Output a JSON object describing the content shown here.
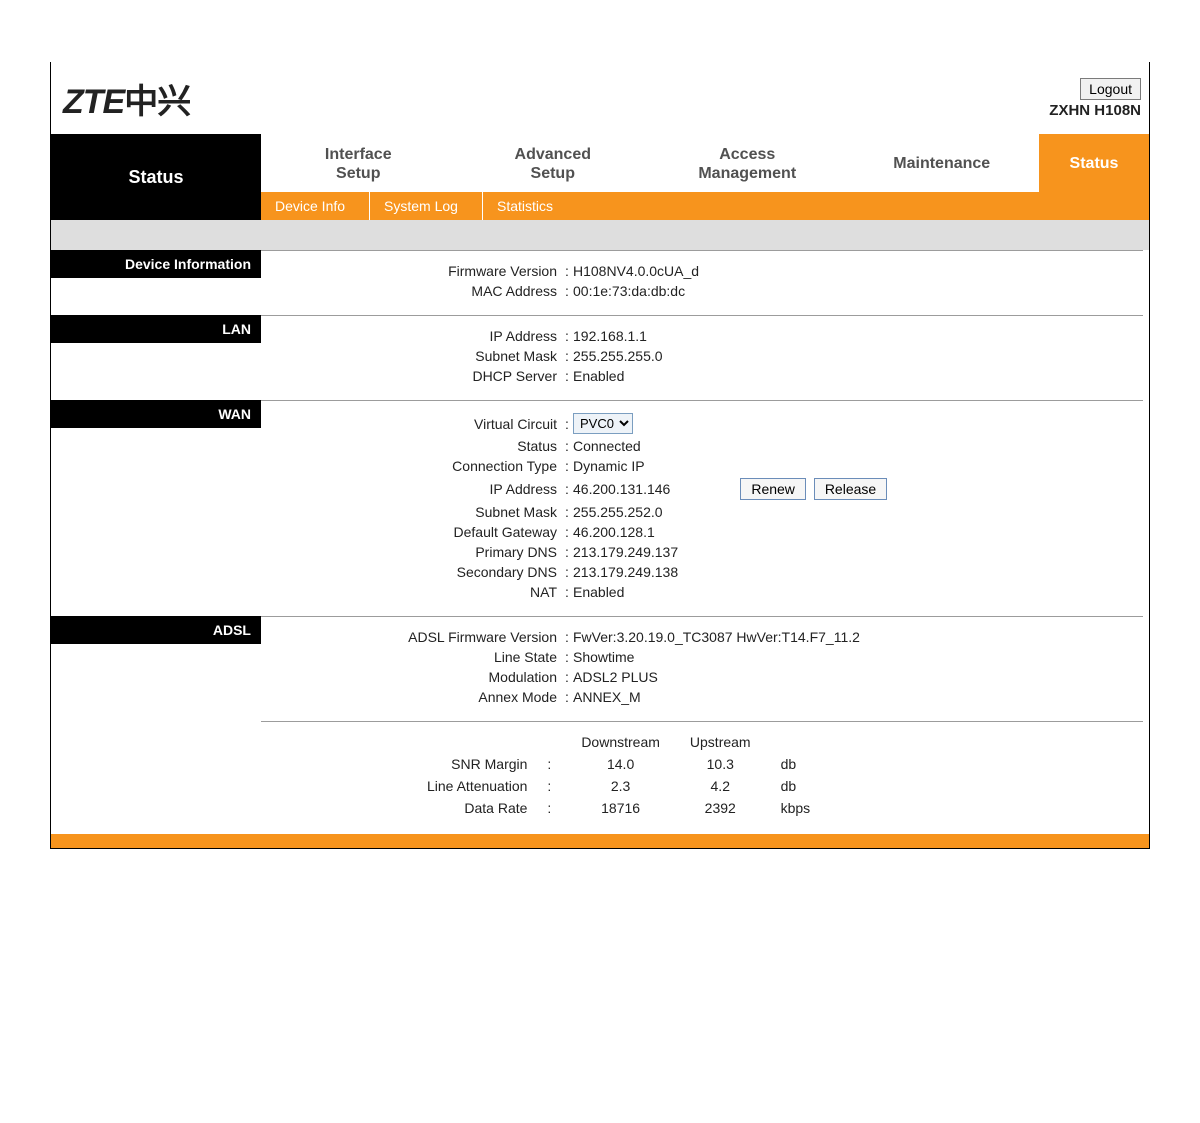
{
  "header": {
    "logo_latin": "ZTE",
    "logo_cn": "中兴",
    "logout": "Logout",
    "model": "ZXHN H108N"
  },
  "tabs": {
    "left_active": "Status",
    "items": [
      {
        "line1": "Interface",
        "line2": "Setup"
      },
      {
        "line1": "Advanced",
        "line2": "Setup"
      },
      {
        "line1": "Access",
        "line2": "Management"
      },
      {
        "line1": "Maintenance",
        "line2": ""
      }
    ],
    "right_active": "Status"
  },
  "subnav": [
    "Device Info",
    "System Log",
    "Statistics"
  ],
  "sections": {
    "device_info": {
      "title": "Device Information",
      "firmware_label": "Firmware Version",
      "firmware": "H108NV4.0.0cUA_d",
      "mac_label": "MAC Address",
      "mac": "00:1e:73:da:db:dc"
    },
    "lan": {
      "title": "LAN",
      "ip_label": "IP Address",
      "ip": "192.168.1.1",
      "mask_label": "Subnet Mask",
      "mask": "255.255.255.0",
      "dhcp_label": "DHCP Server",
      "dhcp": "Enabled"
    },
    "wan": {
      "title": "WAN",
      "vc_label": "Virtual Circuit",
      "vc_selected": "PVC0",
      "status_label": "Status",
      "status": "Connected",
      "conn_label": "Connection Type",
      "conn": "Dynamic IP",
      "ip_label": "IP Address",
      "ip": "46.200.131.146",
      "mask_label": "Subnet Mask",
      "mask": "255.255.252.0",
      "gw_label": "Default Gateway",
      "gw": "46.200.128.1",
      "dns1_label": "Primary DNS",
      "dns1": "213.179.249.137",
      "dns2_label": "Secondary DNS",
      "dns2": "213.179.249.138",
      "nat_label": "NAT",
      "nat": "Enabled",
      "renew_btn": "Renew",
      "release_btn": "Release"
    },
    "adsl": {
      "title": "ADSL",
      "fw_label": "ADSL Firmware Version",
      "fw": "FwVer:3.20.19.0_TC3087 HwVer:T14.F7_11.2",
      "line_label": "Line State",
      "line": "Showtime",
      "mod_label": "Modulation",
      "mod": "ADSL2 PLUS",
      "annex_label": "Annex Mode",
      "annex": "ANNEX_M",
      "col_down": "Downstream",
      "col_up": "Upstream",
      "snr_label": "SNR Margin",
      "snr_down": "14.0",
      "snr_up": "10.3",
      "snr_unit": "db",
      "att_label": "Line Attenuation",
      "att_down": "2.3",
      "att_up": "4.2",
      "att_unit": "db",
      "rate_label": "Data Rate",
      "rate_down": "18716",
      "rate_up": "2392",
      "rate_unit": "kbps"
    }
  },
  "sep": ":"
}
